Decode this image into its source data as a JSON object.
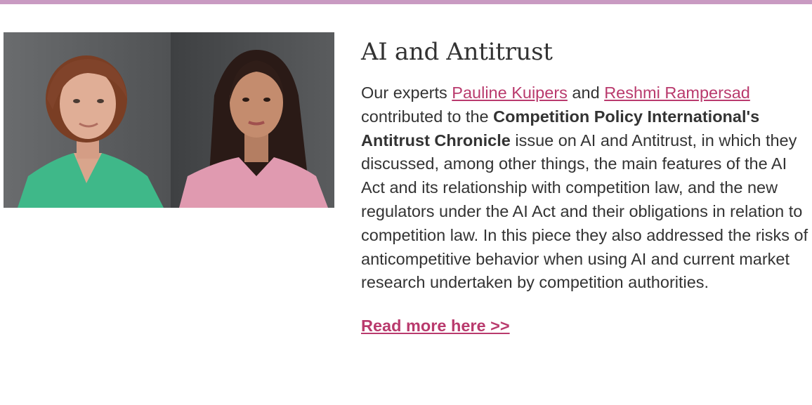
{
  "colors": {
    "top_bar": "#c99ac2",
    "link": "#b93a6d",
    "text": "#333333"
  },
  "article": {
    "title": "AI and Antitrust",
    "intro": "Our experts ",
    "author1": "Pauline Kuipers",
    "and": " and ",
    "author2": "Reshmi Rampersad",
    "contributed": " contributed to the ",
    "publication": "Competition Policy International's Antitrust Chronicle",
    "body": " issue on AI and Antitrust, in which they discussed, among other things, the main features of the AI Act and its relationship with competition law, and the new regulators under the AI Act and their obligations in relation to competition law. In this piece they also addressed the risks of anticompetitive behavior when using AI and current market research undertaken by competition authorities.",
    "read_more": "Read more here >>"
  }
}
